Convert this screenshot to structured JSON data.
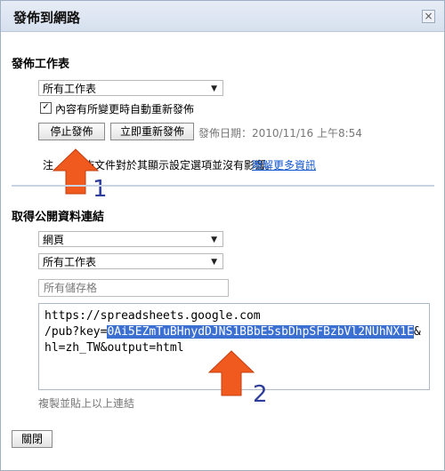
{
  "dialog": {
    "title": "發佈到網路",
    "close_symbol": "×"
  },
  "publish_section": {
    "heading": "發佈工作表",
    "sheet_select": "所有工作表",
    "auto_republish_label": "內容有所變更時自動重新發佈",
    "auto_republish_checked": true,
    "stop_button": "停止發佈",
    "republish_button": "立即重新發佈",
    "publish_date": "發佈日期：2010/11/16 上午8:54",
    "note_prefix": "注",
    "note_text": "佈文件對於其顯示設定選項並沒有影響。",
    "learn_more_link": "瞭解更多資訊"
  },
  "link_section": {
    "heading": "取得公開資料連結",
    "format_select": "網頁",
    "sheet_select": "所有工作表",
    "cells_placeholder": "所有儲存格",
    "url_line1": "https://spreadsheets.google.com",
    "url_line2_prefix": "/pub?key=",
    "url_key_highlight": "0Ai5EZmTuBHnydDJNS1BBbE5sbDhpSFBzbVl2NUhNX1E",
    "url_line2_suffix": "&",
    "url_line3": "hl=zh_TW&output=html",
    "copy_hint": "複製並貼上以上連結"
  },
  "footer": {
    "close_button": "關閉"
  },
  "annotations": {
    "label_1": "1",
    "label_2": "2",
    "arrow_color": "#f05a1e",
    "number_color": "#2e3d9c"
  },
  "select_arrow": "▼"
}
